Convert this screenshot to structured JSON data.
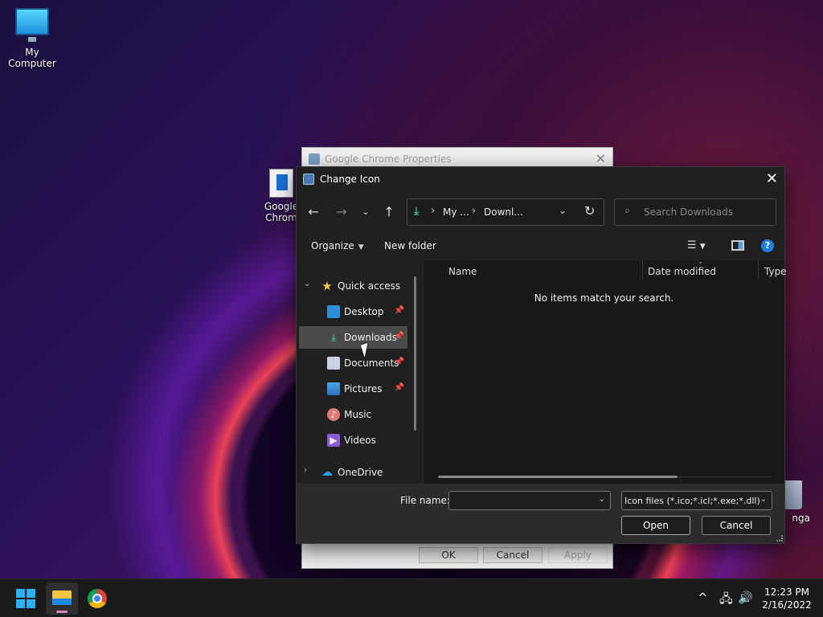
{
  "desktop": {
    "my_computer_label": "My Computer",
    "shortcut_label_line1": "Google",
    "shortcut_label_line2": "Chrom",
    "recycle_label": "nga"
  },
  "properties_window": {
    "title": "Google Chrome Properties",
    "ok_label": "OK",
    "cancel_label": "Cancel",
    "apply_label": "Apply"
  },
  "dialog": {
    "title": "Change Icon",
    "address": {
      "segments": [
        "My ...",
        "Downl..."
      ]
    },
    "search": {
      "placeholder": "Search Downloads"
    },
    "commands": {
      "organize_label": "Organize",
      "new_folder_label": "New folder"
    },
    "nav_pane": {
      "items": [
        {
          "label": "Quick access",
          "icon": "star-icon",
          "pinned": false
        },
        {
          "label": "Desktop",
          "icon": "desktop-icon",
          "pinned": true
        },
        {
          "label": "Downloads",
          "icon": "download-icon",
          "pinned": true,
          "selected": true
        },
        {
          "label": "Documents",
          "icon": "document-icon",
          "pinned": true
        },
        {
          "label": "Pictures",
          "icon": "pictures-icon",
          "pinned": true
        },
        {
          "label": "Music",
          "icon": "music-icon",
          "pinned": false
        },
        {
          "label": "Videos",
          "icon": "videos-icon",
          "pinned": false
        },
        {
          "label": "OneDrive",
          "icon": "cloud-icon",
          "pinned": false
        }
      ]
    },
    "file_list": {
      "columns": [
        "Name",
        "Date modified",
        "Type"
      ],
      "empty_message": "No items match your search."
    },
    "bottom": {
      "file_name_label": "File name:",
      "file_name_value": "",
      "file_type_value": "Icon files (*.ico;*.icl;*.exe;*.dll)",
      "open_label": "Open",
      "cancel_label": "Cancel"
    }
  },
  "taskbar": {
    "clock_time": "12:23 PM",
    "clock_date": "2/16/2022"
  },
  "colors": {
    "accent": "#1f7fd8",
    "download_green": "#3fb87a",
    "dialog_bg": "#202020"
  }
}
